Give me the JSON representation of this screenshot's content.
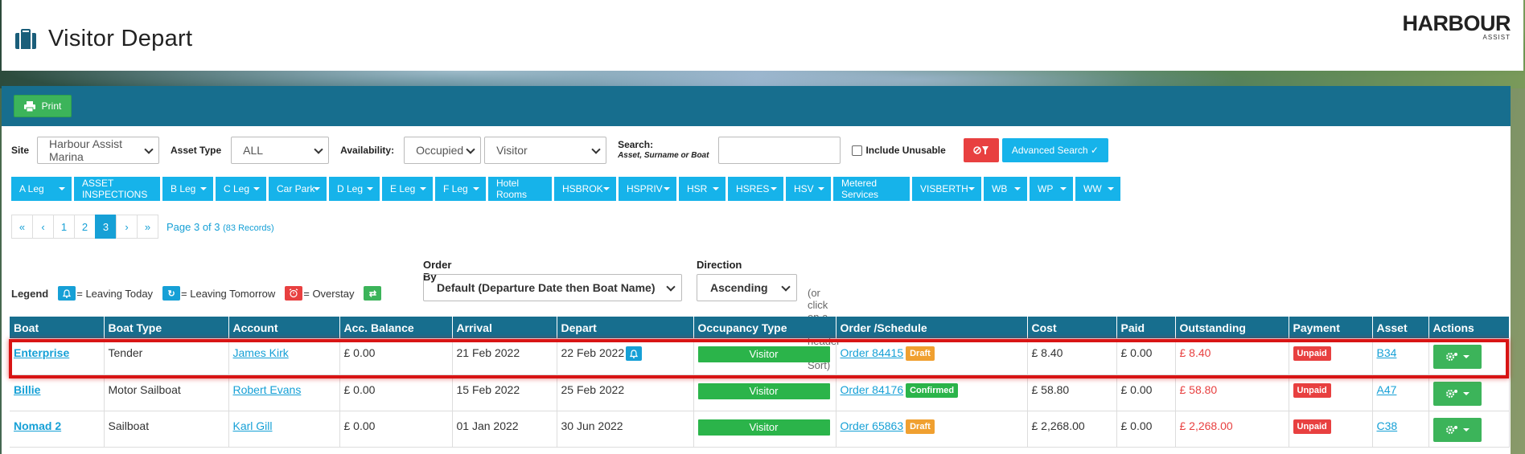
{
  "header": {
    "title": "Visitor Depart",
    "logo_main": "HARBOUR",
    "logo_sub": "ASSIST"
  },
  "toolbar": {
    "print_label": "Print"
  },
  "filters": {
    "site_label": "Site",
    "site_value": "Harbour Assist Marina",
    "asset_type_label": "Asset Type",
    "asset_type_value": "ALL",
    "availability_label": "Availability:",
    "availability_value": "Occupied",
    "visitor_value": "Visitor",
    "search_label": "Search:",
    "search_hint": "Asset, Surname or Boat",
    "search_value": "",
    "include_unusable_label": "Include Unusable",
    "advanced_label": "Advanced Search ✓"
  },
  "tags": [
    "A Leg",
    "ASSET INSPECTIONS",
    "B Leg",
    "C Leg",
    "Car Park",
    "D Leg",
    "E Leg",
    "F Leg",
    "Hotel Rooms",
    "HSBROK",
    "HSPRIV",
    "HSR",
    "HSRES",
    "HSV",
    "Metered Services",
    "VISBERTH",
    "WB",
    "WP",
    "WW"
  ],
  "pager": {
    "first": "«",
    "prev": "‹",
    "p1": "1",
    "p2": "2",
    "p3": "3",
    "next": "›",
    "last": "»",
    "info": "Page 3 of 3",
    "records": "(83 Records)"
  },
  "legend": {
    "label": "Legend",
    "today": "= Leaving Today",
    "tomorrow": "= Leaving Tomorrow",
    "overstay": "= Overstay"
  },
  "order": {
    "label": "Order By",
    "value": "Default (Departure Date then Boat Name)"
  },
  "direction": {
    "label": "Direction",
    "value": "Ascending"
  },
  "sort_hint": "(or click on a column header to Sort)",
  "table": {
    "headers": [
      "Boat",
      "Boat Type",
      "Account",
      "Acc. Balance",
      "Arrival",
      "Depart",
      "Occupancy Type",
      "Order /Schedule",
      "Cost",
      "Paid",
      "Outstanding",
      "Payment",
      "Asset",
      "Actions"
    ],
    "rows": [
      {
        "boat": "Enterprise",
        "type": "Tender",
        "account": "James Kirk",
        "balance": "£ 0.00",
        "arrival": "21 Feb 2022",
        "depart": "22 Feb 2022",
        "occupancy": "Visitor",
        "order": "Order 84415",
        "status": "Draft",
        "cost": "£ 8.40",
        "paid": "£ 0.00",
        "outstanding": "£ 8.40",
        "payment": "Unpaid",
        "asset": "B34"
      },
      {
        "boat": "Billie",
        "type": "Motor Sailboat",
        "account": "Robert Evans",
        "balance": "£ 0.00",
        "arrival": "15 Feb 2022",
        "depart": "25 Feb 2022",
        "occupancy": "Visitor",
        "order": "Order 84176",
        "status": "Confirmed",
        "cost": "£ 58.80",
        "paid": "£ 0.00",
        "outstanding": "£ 58.80",
        "payment": "Unpaid",
        "asset": "A47"
      },
      {
        "boat": "Nomad 2",
        "type": "Sailboat",
        "account": "Karl Gill",
        "balance": "£ 0.00",
        "arrival": "01 Jan 2022",
        "depart": "30 Jun 2022",
        "occupancy": "Visitor",
        "order": "Order 65863",
        "status": "Draft",
        "cost": "£ 2,268.00",
        "paid": "£ 0.00",
        "outstanding": "£ 2,268.00",
        "payment": "Unpaid",
        "asset": "C38"
      }
    ]
  },
  "colors": {
    "header_bar": "#176e8e",
    "accent_blue": "#16b3ea",
    "green": "#3cb45a",
    "red": "#e84040",
    "draft": "#f0a030"
  }
}
